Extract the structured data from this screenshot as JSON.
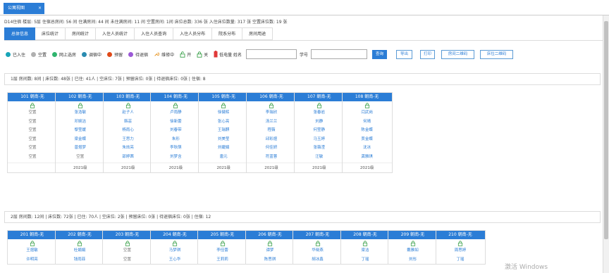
{
  "top_tab": {
    "label": "公寓视图",
    "close": "×"
  },
  "summary": "D14住宿 楼层:   5层   住宿总房间: 56 间   住满房间: 44 间   未住满房间: 11 间   空置房间: 1间   床位总数: 336 张   入住床位数量: 317 张   空置床位数: 19 张",
  "tabs": [
    {
      "label": "总体信息"
    },
    {
      "label": "床位统计"
    },
    {
      "label": "房间统计"
    },
    {
      "label": "入住人员统计"
    },
    {
      "label": "入住人员查询"
    },
    {
      "label": "入住人员分布"
    },
    {
      "label": "院系分布"
    },
    {
      "label": "房间用途"
    }
  ],
  "legend": [
    {
      "label": "已入住",
      "color": "#18a5b8"
    },
    {
      "label": "空置",
      "color": "#b0b0b0"
    },
    {
      "label": "网上选房",
      "color": "#2fb46e"
    },
    {
      "label": "调宿中",
      "color": "#2a8bb0"
    },
    {
      "label": "预留",
      "color": "#e04a18"
    },
    {
      "label": "待退宿",
      "color": "#9b59d6"
    },
    {
      "label": "维修中",
      "color": "#e89a2c"
    },
    {
      "label": "开",
      "color": "#3aa04a"
    },
    {
      "label": "关",
      "color": "#3aa04a"
    },
    {
      "label": "低电量",
      "color": "#e03a3a"
    }
  ],
  "search": {
    "name_label": "姓名",
    "id_label": "学号",
    "query": "查询",
    "export": "导出",
    "print": "打印",
    "room_qr": "房间二维码",
    "bed_qr": "床位二维码"
  },
  "floors": [
    {
      "info": "1层    房间数: 8间 | 床位数: 48张 | 已住: 41人 | 空床位: 7张 | 预留床位: 0张 | 待退宿床位: 0张 | 住宿: 8",
      "rooms": [
        {
          "name": "101 朝南-无",
          "beds": [
            "空置",
            "空置",
            "空置",
            "空置",
            "空置",
            "空置"
          ],
          "year": ""
        },
        {
          "name": "102 朝南-无",
          "beds": [
            "张浩敏",
            "邓婉洁",
            "黎莹媛",
            "梁金蝶",
            "曾煜梦",
            "空置"
          ],
          "year": "2021级"
        },
        {
          "name": "103 朝南-无",
          "beds": [
            "赵子人",
            "韩芸",
            "杨雨心",
            "王思力",
            "朱炫亮",
            "邵婷茜"
          ],
          "year": "2021级"
        },
        {
          "name": "104 朝南-无",
          "beds": [
            "卢雨静",
            "徐新蕾",
            "刘春带",
            "朱形",
            "李秋萌",
            "刘梦含"
          ],
          "year": "2021级"
        },
        {
          "name": "105 朝南-无",
          "beds": [
            "徐健辉",
            "张心亮",
            "王瑞麒",
            "刘美莹",
            "刘婕娟",
            "唐元"
          ],
          "year": "2021级"
        },
        {
          "name": "106 朝南-无",
          "beds": [
            "李瑞欣",
            "汤兰兰",
            "程薇",
            "邱彩煜",
            "何佳妍",
            "符蓝蓉"
          ],
          "year": "2021级"
        },
        {
          "name": "107 朝南-无",
          "beds": [
            "张春岩",
            "刘静",
            "何莹静",
            "马玉婷",
            "张薇滢",
            "汪敏"
          ],
          "year": "2021级"
        },
        {
          "name": "108 朝南-无",
          "beds": [
            "闫武岗",
            "何晴",
            "陈金蝶",
            "贾金蝶",
            "沈冰",
            "龚雅琪"
          ],
          "year": "2021级"
        }
      ]
    },
    {
      "info": "2层    房间数: 12间 | 床位数: 72张 | 已住: 70人 | 空床位: 2张 | 预留床位: 0张 | 待退宿床位: 0张 | 住宿: 12",
      "rooms": [
        {
          "name": "201 朝南-无",
          "beds": [
            "王煜敏",
            "许明亮",
            "",
            "",
            "",
            ""
          ],
          "year": ""
        },
        {
          "name": "202 朝南-无",
          "beds": [
            "杜娟娟",
            "钱雨菲",
            "",
            "",
            "",
            ""
          ],
          "year": ""
        },
        {
          "name": "203 朝南-无",
          "beds": [
            "空置",
            "空置",
            "",
            "",
            "",
            ""
          ],
          "year": ""
        },
        {
          "name": "204 朝南-无",
          "beds": [
            "马梦琪",
            "王心华",
            "",
            "",
            "",
            ""
          ],
          "year": ""
        },
        {
          "name": "205 朝南-无",
          "beds": [
            "李佳蕾",
            "王莉莉",
            "",
            "",
            "",
            ""
          ],
          "year": ""
        },
        {
          "name": "206 朝南-无",
          "beds": [
            "谭梦",
            "陈思琪",
            "",
            "",
            "",
            ""
          ],
          "year": ""
        },
        {
          "name": "207 朝南-无",
          "beds": [
            "华晓燕",
            "胡冰鑫",
            "",
            "",
            "",
            ""
          ],
          "year": ""
        },
        {
          "name": "208 朝南-无",
          "beds": [
            "梁洁",
            "丁瑶",
            "",
            "",
            "",
            ""
          ],
          "year": ""
        },
        {
          "name": "209 朝南-无",
          "beds": [
            "戴雅如",
            "刘彤",
            "",
            "",
            "",
            ""
          ],
          "year": ""
        },
        {
          "name": "210 朝南-无",
          "beds": [
            "周思婷",
            "丁瑶",
            "",
            "",
            "",
            ""
          ],
          "year": ""
        }
      ]
    }
  ],
  "watermark": "激活 Windows"
}
